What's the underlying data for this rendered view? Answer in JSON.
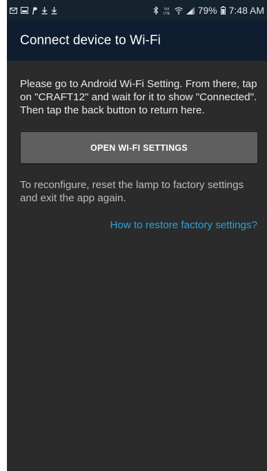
{
  "status_bar": {
    "icons_left": [
      "email-icon",
      "gallery-icon",
      "paypal-icon",
      "download-icon",
      "download-icon"
    ],
    "icons_right": [
      "bluetooth-icon",
      "volte-icon",
      "wifi-icon",
      "signal-icon",
      "battery-icon"
    ],
    "volte_label": "Vol LTE",
    "battery_percent": "79%",
    "time": "7:48 AM"
  },
  "app_bar": {
    "title": "Connect device to Wi-Fi"
  },
  "main": {
    "instructions": "Please go to Android Wi-Fi Setting. From there, tap on \"CRAFT12\" and wait for it to show \"Connected\". Then tap the back button to return here.",
    "open_settings_label": "OPEN WI-FI SETTINGS",
    "reconfigure_text": "To reconfigure, reset the lamp to factory settings and exit the app again.",
    "restore_link": "How to restore factory settings?"
  },
  "colors": {
    "status_bar_bg": "#15232e",
    "app_bar_bg": "#0e1e30",
    "content_bg": "#2b2b2b",
    "button_bg": "#5f5f5f",
    "link": "#2aa3dd"
  }
}
